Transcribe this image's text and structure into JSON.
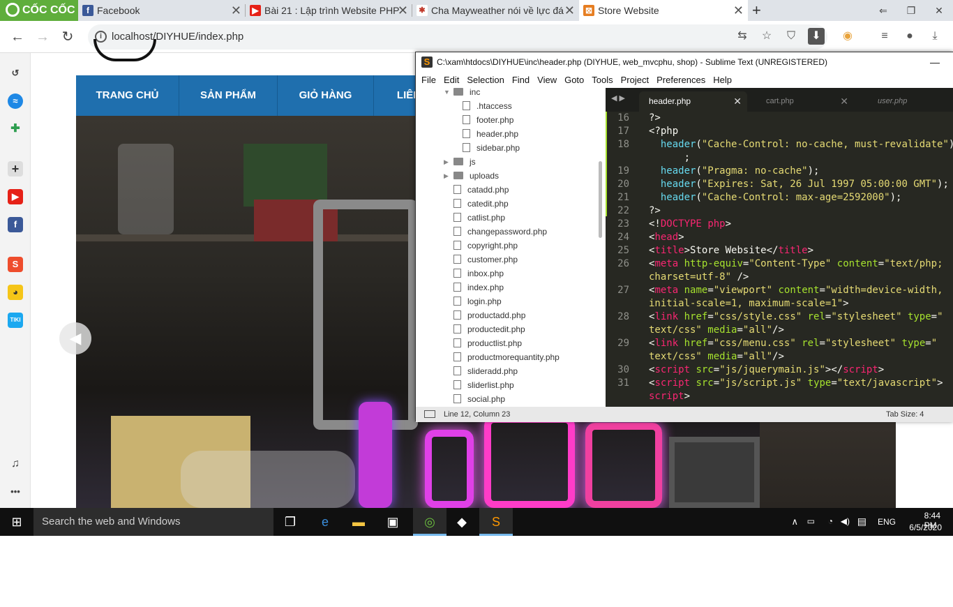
{
  "browser": {
    "brand": "CỐC CỐC",
    "tabs": [
      {
        "title": "Facebook",
        "icon": "facebook-icon",
        "active": false
      },
      {
        "title": "Bài 21 : Lập trình Website PHP",
        "icon": "youtube-icon",
        "active": false
      },
      {
        "title": "Cha Mayweather nói về lực đá",
        "icon": "news-icon",
        "active": false
      },
      {
        "title": "Store Website",
        "icon": "store-icon",
        "active": true
      }
    ],
    "new_tab_label": "+",
    "url": "localhost/DIYHUE/index.php"
  },
  "website": {
    "menu": [
      "TRANG CHỦ",
      "SẢN PHẨM",
      "GIỎ HÀNG",
      "LIÊN"
    ],
    "slider_prev": "◀"
  },
  "sublime": {
    "title": "C:\\xam\\htdocs\\DIYHUE\\inc\\header.php (DIYHUE, web_mvcphu, shop) - Sublime Text (UNREGISTERED)",
    "menu": [
      "File",
      "Edit",
      "Selection",
      "Find",
      "View",
      "Goto",
      "Tools",
      "Project",
      "Preferences",
      "Help"
    ],
    "tree": {
      "folder_inc": "inc",
      "inc_files": [
        ".htaccess",
        "footer.php",
        "header.php",
        "sidebar.php"
      ],
      "folders": [
        "js",
        "uploads"
      ],
      "files": [
        "catadd.php",
        "catedit.php",
        "catlist.php",
        "changepassword.php",
        "copyright.php",
        "customer.php",
        "inbox.php",
        "index.php",
        "login.php",
        "productadd.php",
        "productedit.php",
        "productlist.php",
        "productmorequantity.php",
        "slideradd.php",
        "sliderlist.php",
        "social.php"
      ]
    },
    "tabs": [
      "header.php",
      "cart.php",
      "user.php"
    ],
    "line_numbers": [
      "16",
      "17",
      "18",
      "",
      "19",
      "20",
      "21",
      "22",
      "23",
      "24",
      "25",
      "26",
      "",
      "27",
      "",
      "28",
      "",
      "29",
      "",
      "30",
      "31",
      ""
    ],
    "status_position": "Line 12, Column 23",
    "status_tabsize": "Tab Size: 4"
  },
  "taskbar": {
    "search_placeholder": "Search the web and Windows",
    "language": "ENG",
    "time": "8:44 PM",
    "date": "6/5/2020"
  }
}
